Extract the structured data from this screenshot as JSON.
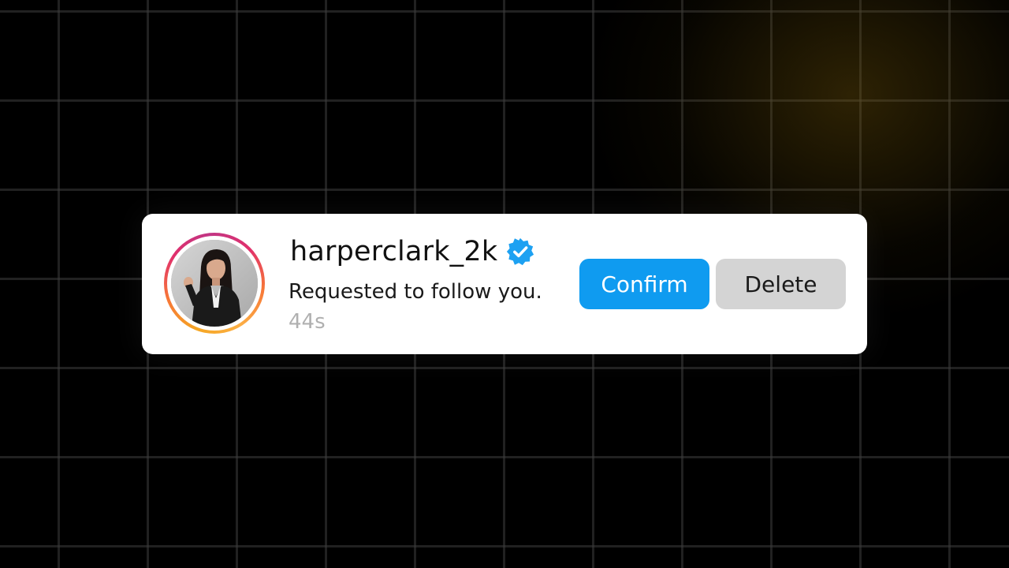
{
  "notification": {
    "username": "harperclark_2k",
    "verified": true,
    "message": "Requested to follow you.",
    "timestamp": "44s",
    "actions": {
      "confirm_label": "Confirm",
      "delete_label": "Delete"
    }
  },
  "icons": {
    "verified": "verified-badge-icon",
    "avatar": "profile-avatar"
  },
  "colors": {
    "confirm_button": "#0f9bf0",
    "delete_button": "#d4d4d4",
    "verified_badge": "#1da1f2",
    "timestamp": "#b0b0b0",
    "card_background": "#ffffff",
    "page_background": "#000000"
  }
}
